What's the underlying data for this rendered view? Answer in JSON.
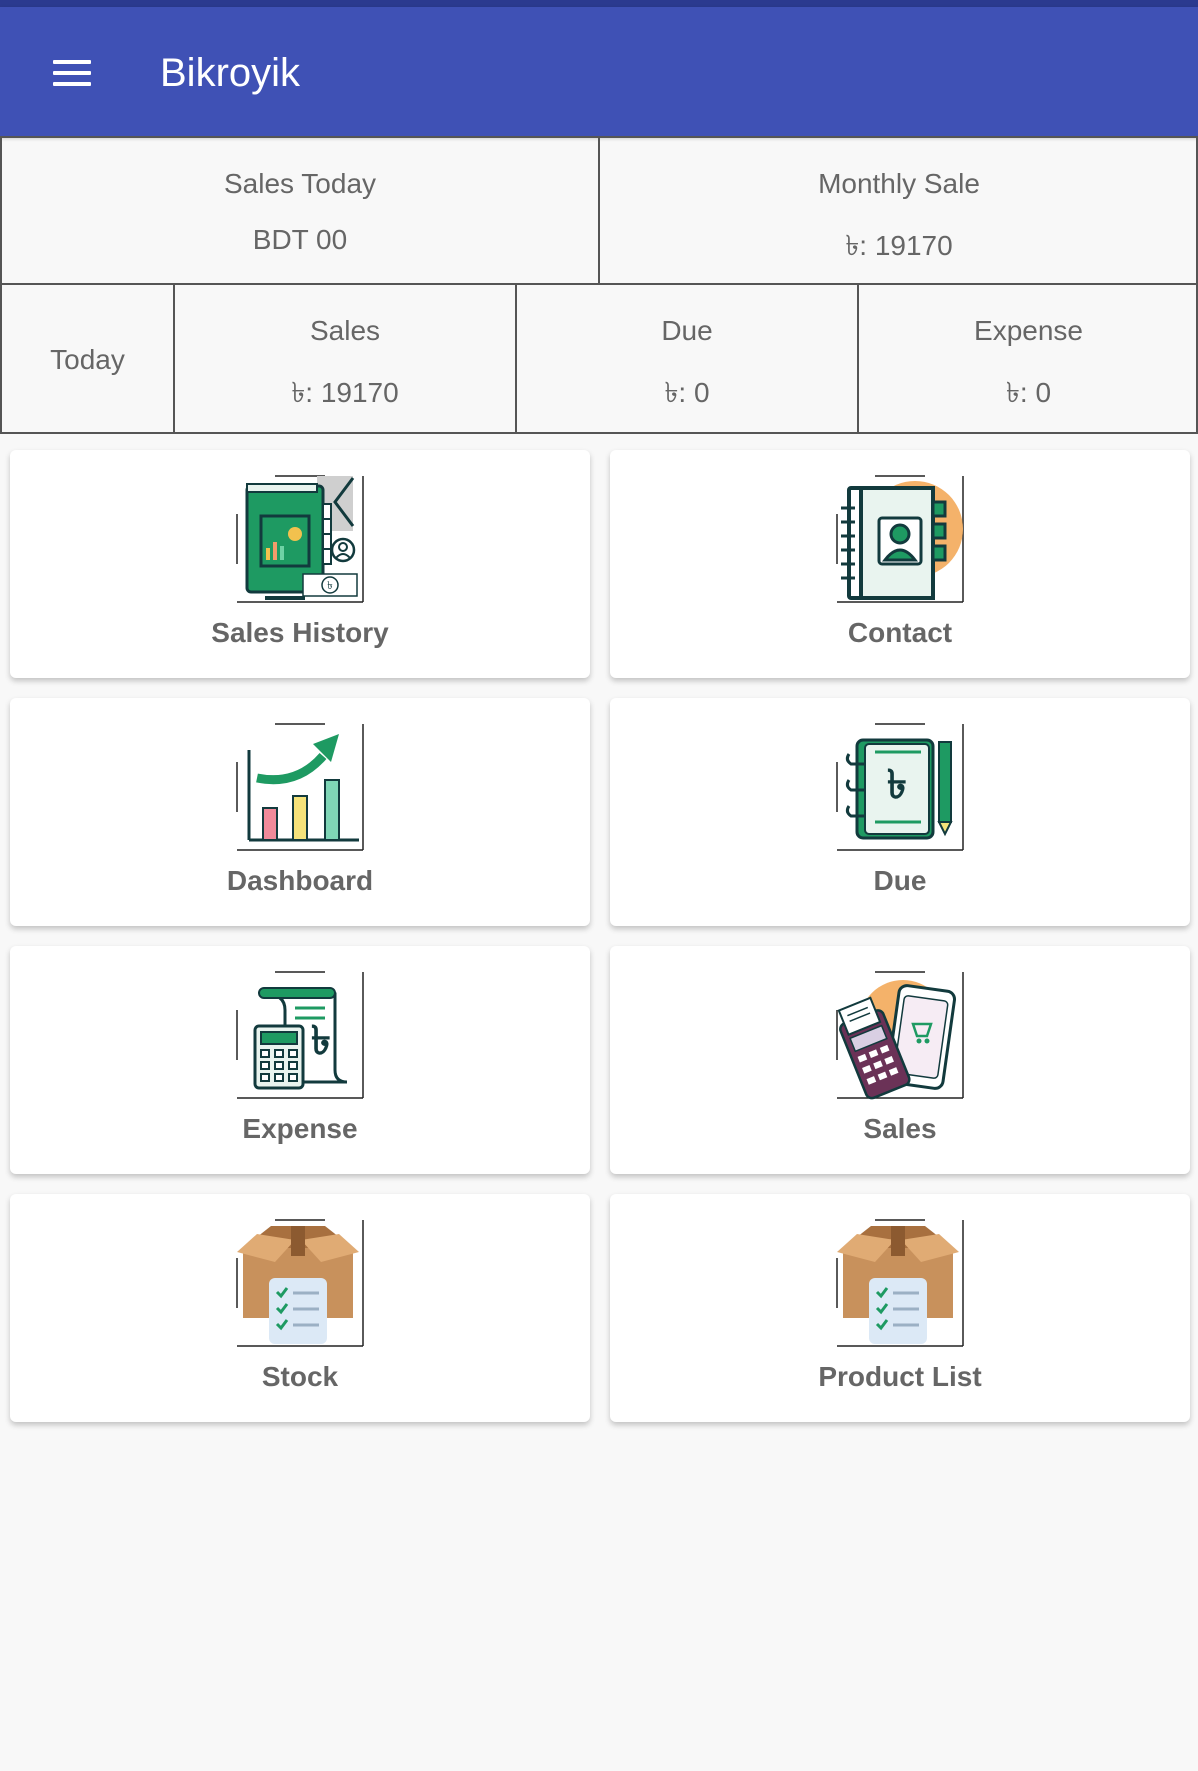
{
  "app": {
    "title": "Bikroyik"
  },
  "summary": {
    "sales_today": {
      "label": "Sales Today",
      "value": "BDT 00"
    },
    "monthly_sale": {
      "label": "Monthly Sale",
      "value": "৳: 19170"
    }
  },
  "today": {
    "label": "Today",
    "sales": {
      "label": "Sales",
      "value": "৳: 19170"
    },
    "due": {
      "label": "Due",
      "value": "৳: 0"
    },
    "expense": {
      "label": "Expense",
      "value": "৳: 0"
    }
  },
  "menu": [
    {
      "label": "Sales History",
      "icon": "sales-history-icon"
    },
    {
      "label": "Contact",
      "icon": "contact-book-icon"
    },
    {
      "label": "Dashboard",
      "icon": "bar-chart-growth-icon"
    },
    {
      "label": "Due",
      "icon": "due-notebook-icon"
    },
    {
      "label": "Expense",
      "icon": "calculator-receipt-icon"
    },
    {
      "label": "Sales",
      "icon": "pos-terminal-icon"
    },
    {
      "label": "Stock",
      "icon": "box-checklist-icon"
    },
    {
      "label": "Product List",
      "icon": "box-checklist-icon"
    }
  ],
  "colors": {
    "appbar": "#3f51b5",
    "accent_green": "#1e9a62",
    "dark_teal": "#123a3d"
  }
}
